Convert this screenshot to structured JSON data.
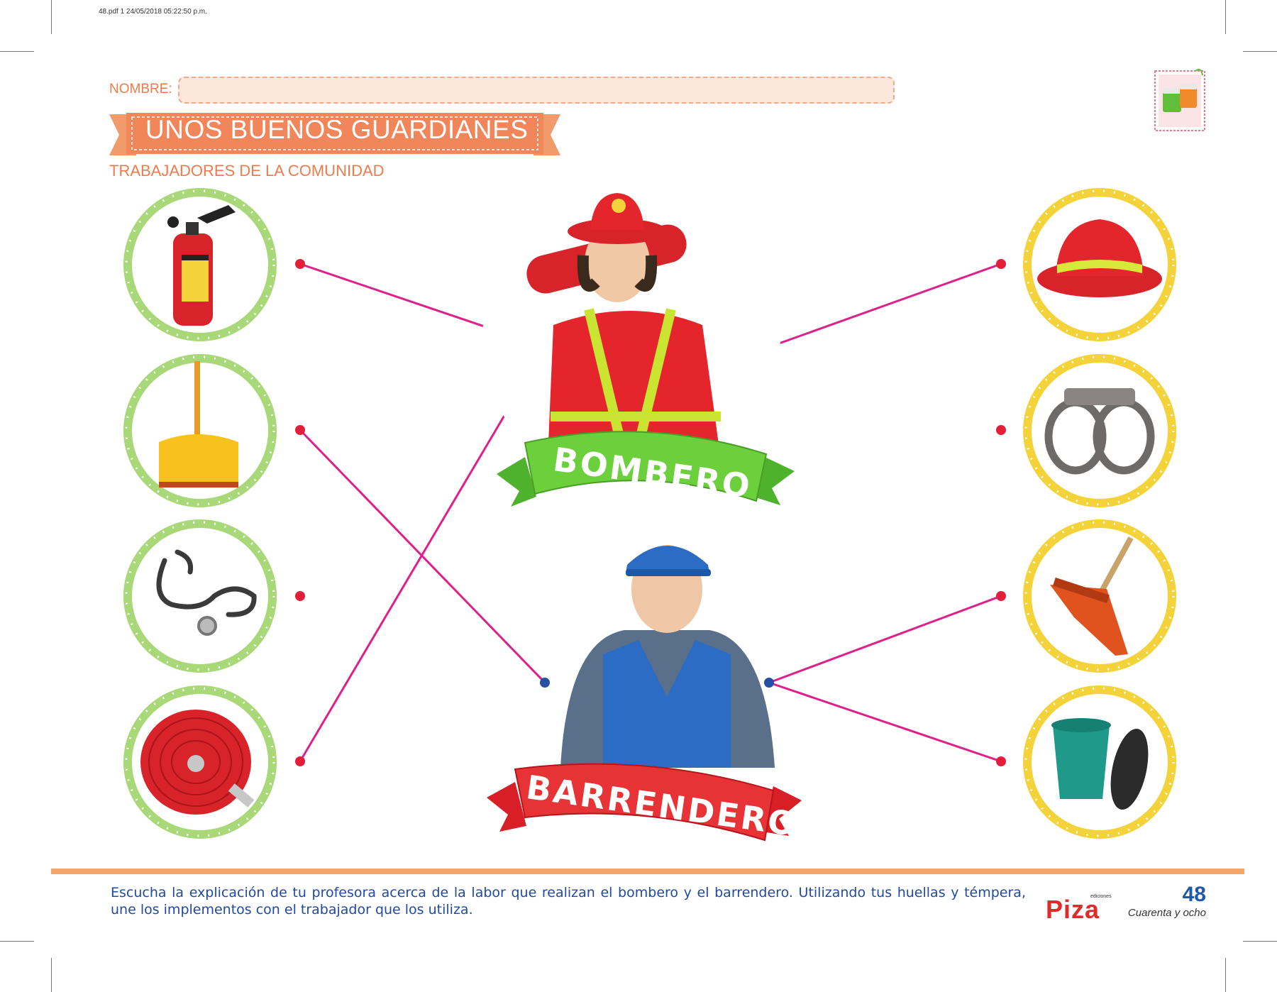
{
  "header": {
    "print_info": "48.pdf   1   24/05/2018   05:22:50 p.m."
  },
  "form": {
    "name_label": "NOMBRE:"
  },
  "title": "UNOS BUENOS GUARDIANES",
  "subtitle": "TRABAJADORES DE LA COMUNIDAD",
  "workers": {
    "firefighter_label": "BOMBERO",
    "sweeper_label": "BARRENDERO"
  },
  "items": {
    "left": [
      {
        "name": "fire-extinguisher"
      },
      {
        "name": "dustpan"
      },
      {
        "name": "stethoscope"
      },
      {
        "name": "fire-hose"
      }
    ],
    "right": [
      {
        "name": "firefighter-helmet"
      },
      {
        "name": "handcuffs"
      },
      {
        "name": "broom"
      },
      {
        "name": "trash-can"
      }
    ]
  },
  "footer": {
    "instructions": "Escucha la explicación de tu profesora acerca de la labor que realizan el bombero y el barrendero. Utilizando tus huellas y témpera, une los implementos con el trabajador que los utiliza.",
    "brand_small": "ediciones",
    "brand": "Piza",
    "page_number": "48",
    "page_number_words": "Cuarenta y ocho"
  },
  "colors": {
    "orange": "#ee7b4b",
    "green_ring": "#a8d878",
    "yellow_ring": "#f4d33a",
    "connector": "#e0208a",
    "dot_red": "#e31e3a",
    "dot_blue": "#2451a5",
    "text_blue": "#1f4b9e"
  }
}
